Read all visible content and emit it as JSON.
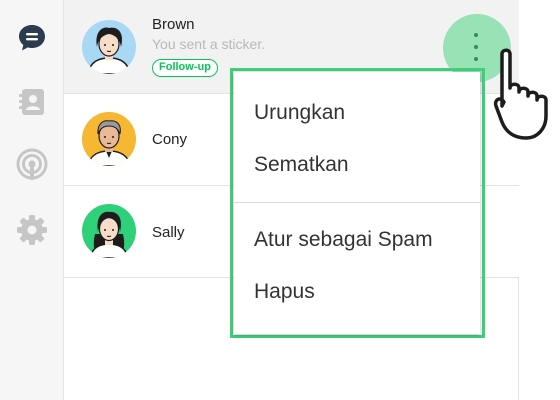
{
  "sidebar": {
    "items": [
      {
        "icon": "chat-bubble-icon",
        "active": true
      },
      {
        "icon": "contacts-icon",
        "active": false
      },
      {
        "icon": "broadcast-icon",
        "active": false
      },
      {
        "icon": "gear-icon",
        "active": false
      }
    ]
  },
  "chats": [
    {
      "name": "Brown",
      "preview": "You sent a sticker.",
      "tag": "Follow-up",
      "selected": true
    },
    {
      "name": "Cony"
    },
    {
      "name": "Sally"
    }
  ],
  "context_menu": {
    "items": [
      "Urungkan",
      "Sematkan",
      "Atur sebagai Spam",
      "Hapus"
    ]
  },
  "colors": {
    "accent": "#06c755",
    "highlight_frame": "#3ed07a",
    "sidebar_icon": "#c6c6c6",
    "sidebar_icon_active": "#2d3b4e"
  }
}
